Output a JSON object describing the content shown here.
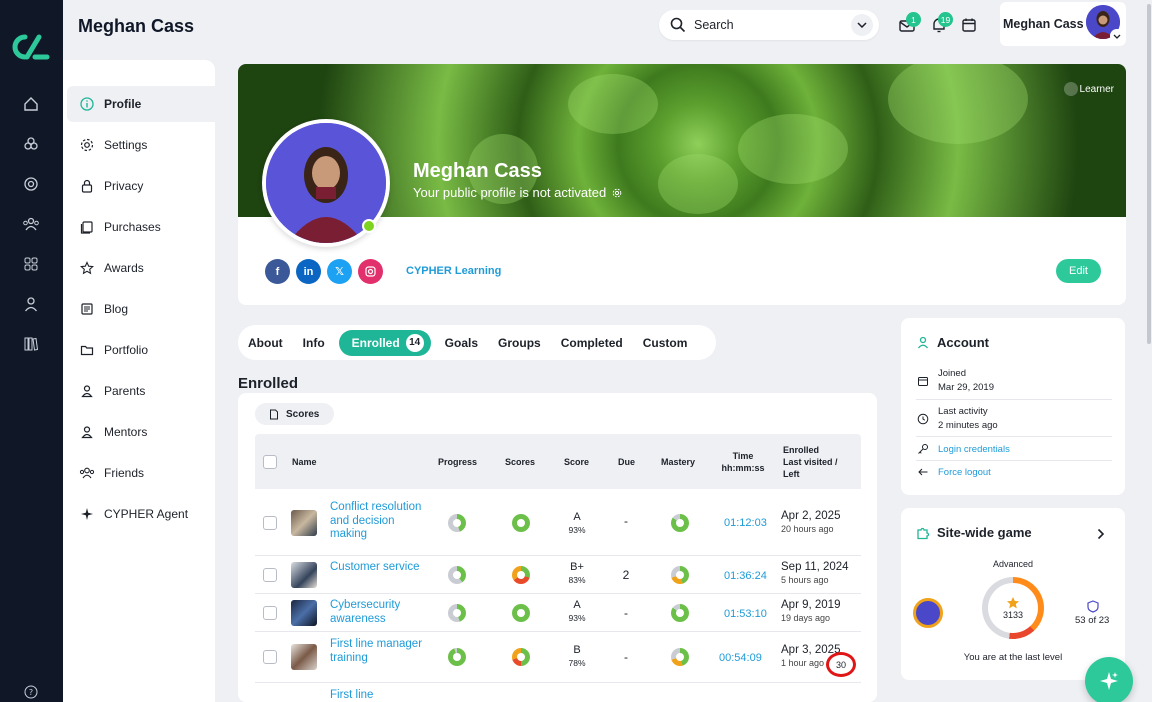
{
  "header": {
    "title": "Meghan Cass",
    "search_placeholder": "Search",
    "user_name": "Meghan Cass",
    "mail_badge": "1",
    "bell_badge": "19"
  },
  "sidebar": {
    "items": [
      {
        "label": "Profile"
      },
      {
        "label": "Settings"
      },
      {
        "label": "Privacy"
      },
      {
        "label": "Purchases"
      },
      {
        "label": "Awards"
      },
      {
        "label": "Blog"
      },
      {
        "label": "Portfolio"
      },
      {
        "label": "Parents"
      },
      {
        "label": "Mentors"
      },
      {
        "label": "Friends"
      },
      {
        "label": "CYPHER Agent"
      }
    ]
  },
  "profile": {
    "name": "Meghan Cass",
    "status": "Your public profile is not activated",
    "role": "Learner",
    "org": "CYPHER Learning",
    "edit": "Edit"
  },
  "tabs": {
    "about": "About",
    "info": "Info",
    "enrolled": "Enrolled",
    "enrolled_count": "14",
    "goals": "Goals",
    "groups": "Groups",
    "completed": "Completed",
    "custom": "Custom"
  },
  "enrolled": {
    "title": "Enrolled",
    "scores_button": "Scores",
    "columns": {
      "name": "Name",
      "progress": "Progress",
      "scores": "Scores",
      "score": "Score",
      "due": "Due",
      "mastery": "Mastery",
      "time": "Time\nhh:mm:ss",
      "enrolled": "Enrolled\nLast visited /\nLeft"
    },
    "rows": [
      {
        "name": "Conflict resolution and decision making",
        "grade": "A",
        "pct": "93%",
        "due": "-",
        "time": "01:12:03",
        "date": "Apr 2, 2025",
        "ago": "20 hours ago"
      },
      {
        "name": "Customer service",
        "grade": "B+",
        "pct": "83%",
        "due": "2",
        "time": "01:36:24",
        "date": "Sep 11, 2024",
        "ago": "5 hours ago"
      },
      {
        "name": "Cybersecurity awareness",
        "grade": "A",
        "pct": "93%",
        "due": "-",
        "time": "01:53:10",
        "date": "Apr 9, 2019",
        "ago": "19 days ago"
      },
      {
        "name": "First line manager training",
        "grade": "B",
        "pct": "78%",
        "due": "-",
        "time": "00:54:09",
        "date": "Apr 3, 2025",
        "ago": "1 hour ago",
        "left": "30"
      },
      {
        "name": "First line"
      }
    ]
  },
  "account": {
    "title": "Account",
    "joined_label": "Joined",
    "joined": "Mar 29, 2019",
    "activity_label": "Last activity",
    "activity": "2 minutes ago",
    "login": "Login credentials",
    "logout": "Force logout"
  },
  "game": {
    "title": "Site-wide game",
    "level": "Advanced",
    "points": "3133",
    "rank": "53 of 23",
    "footer": "You are at the last level"
  },
  "colors": {
    "accent": "#2ec99a",
    "link": "#1f9bd8",
    "rail": "#101828"
  }
}
